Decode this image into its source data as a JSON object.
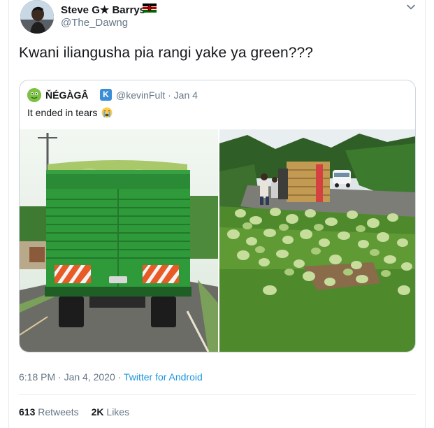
{
  "author": {
    "display_name": "Steve G★ Barrys",
    "handle": "@The_Dawng",
    "flag_icon": "kenya-flag-icon"
  },
  "tweet": {
    "text": "Kwani iliangusha pia rangi yake ya green???"
  },
  "quoted": {
    "display_name": "ŇÉGÀGÂ",
    "badge": "K",
    "handle_date": "@kevinFult · Jan 4",
    "text": "It ended in tears",
    "emoji": "crying-face-emoji"
  },
  "meta": {
    "time_date": "6:18 PM · Jan 4, 2020 · ",
    "source": "Twitter for Android"
  },
  "stats": {
    "retweets_count": "613",
    "retweets_label": "Retweets",
    "likes_count": "2K",
    "likes_label": "Likes"
  },
  "colors": {
    "link": "#1b95e0",
    "secondary_text": "#657786",
    "border": "#ccd6dd",
    "truck_green": "#2e9a3a"
  }
}
